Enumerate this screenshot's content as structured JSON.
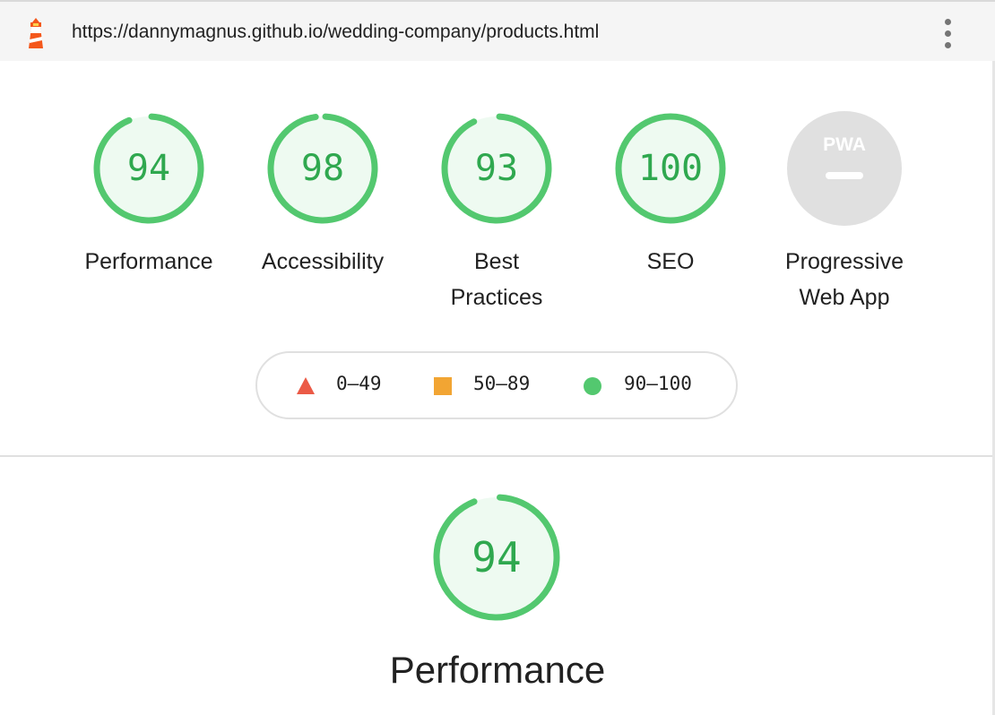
{
  "header": {
    "url": "https://dannymagnus.github.io/wedding-company/products.html",
    "logo_icon": "lighthouse-icon",
    "menu_icon": "more-vertical-icon"
  },
  "categories": [
    {
      "id": "performance",
      "label": "Performance",
      "score": "94",
      "value": 94
    },
    {
      "id": "accessibility",
      "label": "Accessibility",
      "score": "98",
      "value": 98
    },
    {
      "id": "best-practices",
      "label_line1": "Best",
      "label_line2": "Practices",
      "score": "93",
      "value": 93
    },
    {
      "id": "seo",
      "label": "SEO",
      "score": "100",
      "value": 100
    },
    {
      "id": "pwa",
      "label_line1": "Progressive",
      "label_line2": "Web App",
      "badge": "PWA",
      "score": "—"
    }
  ],
  "legend": {
    "fail": "0–49",
    "average": "50–89",
    "pass": "90–100"
  },
  "colors": {
    "pass": "#0cce6b",
    "pass_text": "#2fa84f",
    "pass_bg": "#eefaf1",
    "fail": "#eb5a46",
    "average": "#f2a533",
    "pwa_bg": "#e0e0e0",
    "pwa_fg": "#ffffff"
  },
  "main": {
    "score": "94",
    "value": 94,
    "title": "Performance"
  }
}
